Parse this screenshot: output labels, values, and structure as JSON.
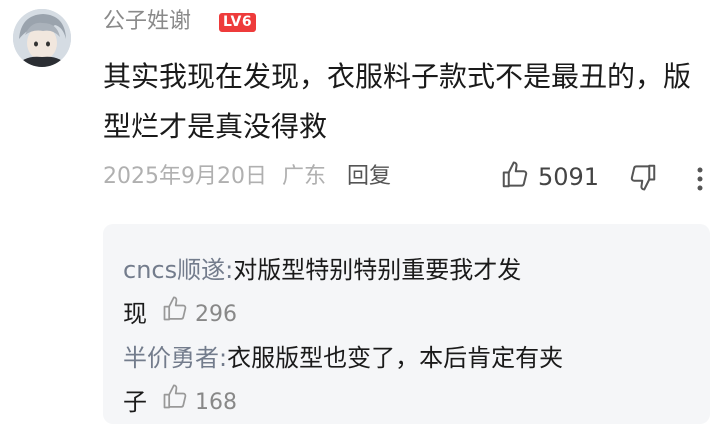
{
  "comment": {
    "username": "公子姓谢",
    "level": "LV6",
    "text": "其实我现在发现，衣服料子款式不是最丑的，版型烂才是真没得救",
    "date": "2025年9月20日",
    "location": "广东",
    "reply_label": "回复",
    "likes": "5091"
  },
  "replies": [
    {
      "name": "cncs顺遂:",
      "text_line1": "对版型特别特别重要我才发",
      "text_line2": "现",
      "likes": "296"
    },
    {
      "name": "半价勇者:",
      "text_line1": "衣服版型也变了，本后肯定有夹",
      "text_line2": "子",
      "likes": "168"
    }
  ],
  "icons": {
    "like": "thumb-up-icon",
    "dislike": "thumb-down-icon",
    "more": "more-vertical-icon"
  },
  "colors": {
    "accent": "#ee3b3b",
    "muted": "#b0b0b0",
    "reply_name": "#737c8c"
  }
}
